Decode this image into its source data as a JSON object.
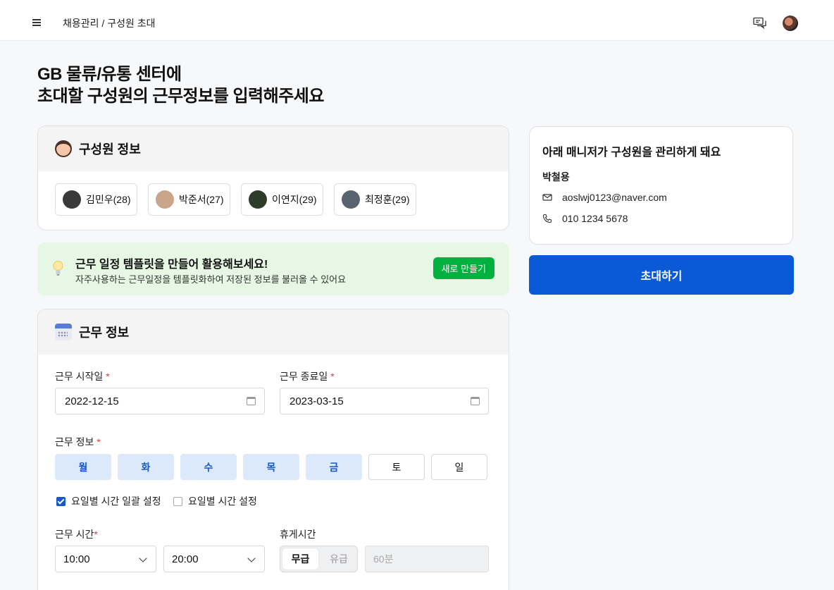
{
  "header": {
    "breadcrumb": "채용관리 / 구성원 초대",
    "icons": [
      "menu-icon",
      "chat-icon",
      "profile-avatar"
    ]
  },
  "headline": {
    "line1": "GB 물류/유통 센터에",
    "line2": "초대할 구성원의 근무정보를 입력해주세요"
  },
  "members_card": {
    "title": "구성원 정보",
    "members": [
      {
        "label": "김민우(28)",
        "avatar_color": "#3a3a3a"
      },
      {
        "label": "박준서(27)",
        "avatar_color": "#c9a58a"
      },
      {
        "label": "이연지(29)",
        "avatar_color": "#2f3b2a"
      },
      {
        "label": "최정훈(29)",
        "avatar_color": "#5a6470"
      }
    ]
  },
  "tip": {
    "title": "근무 일정 템플릿을 만들어 활용해보세요!",
    "description": "자주사용하는 근무일정을 템플릿화하여 저장된 정보를 불러올 수 있어요",
    "button": "새로 만들기"
  },
  "work_card": {
    "title": "근무 정보",
    "start_label": "근무 시작일",
    "start_value": "2022-12-15",
    "end_label": "근무 종료일",
    "end_value": "2023-03-15",
    "days_label": "근무 정보",
    "required_mark": "*",
    "days": [
      {
        "label": "월",
        "selected": true
      },
      {
        "label": "화",
        "selected": true
      },
      {
        "label": "수",
        "selected": true
      },
      {
        "label": "목",
        "selected": true
      },
      {
        "label": "금",
        "selected": true
      },
      {
        "label": "토",
        "selected": false
      },
      {
        "label": "일",
        "selected": false
      }
    ],
    "option_batch": "요일별 시간 일괄 설정",
    "option_individual": "요일별 시간  설정",
    "time_label": "근무 시간",
    "time_start": "10:00",
    "time_end": "20:00",
    "break_label": "휴게시간",
    "break_unpaid": "무급",
    "break_paid": "유급",
    "break_duration_placeholder": "60분"
  },
  "manager": {
    "title": "아래 매니저가 구성원을 관리하게 돼요",
    "name": "박철용",
    "email": "aoslwj0123@naver.com",
    "phone": "010 1234 5678"
  },
  "invite_button": "초대하기",
  "colors": {
    "primary": "#0a5ad8",
    "green": "#00b140",
    "selected_day_bg": "#dce9fb",
    "selected_day_text": "#1858c9",
    "required": "#e23c3c"
  }
}
